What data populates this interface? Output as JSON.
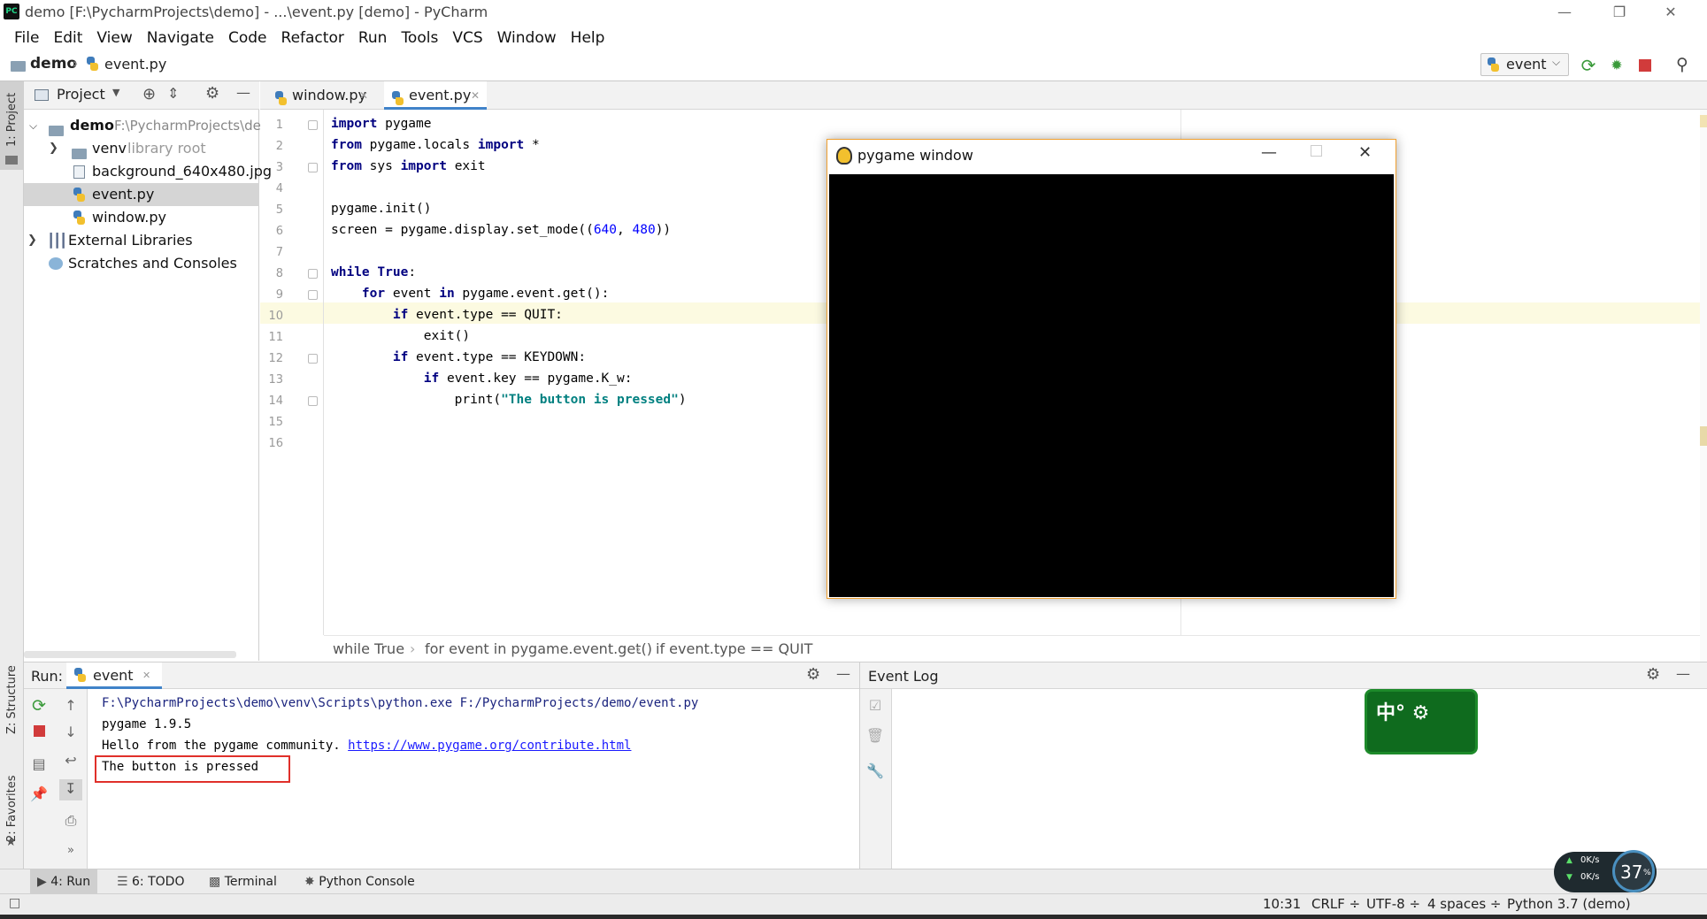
{
  "window": {
    "app_icon": "PC",
    "title": "demo [F:\\PycharmProjects\\demo] - ...\\event.py [demo] - PyCharm",
    "minimize_icon": "minimize-icon",
    "restore_icon": "restore-icon",
    "close_icon": "close-icon"
  },
  "menu": [
    "File",
    "Edit",
    "View",
    "Navigate",
    "Code",
    "Refactor",
    "Run",
    "Tools",
    "VCS",
    "Window",
    "Help"
  ],
  "navbar": {
    "project": "demo",
    "file": "event.py",
    "run_config": "event"
  },
  "left_strip": {
    "project": "1: Project",
    "structure": "Z: Structure",
    "favorites": "2: Favorites"
  },
  "project_panel": {
    "title": "Project",
    "tree": [
      {
        "label": "demo",
        "extra": "F:\\PycharmProjects\\de"
      },
      {
        "label": "venv",
        "extra": "library root"
      },
      {
        "label": "background_640x480.jpg"
      },
      {
        "label": "event.py"
      },
      {
        "label": "window.py"
      },
      {
        "label": "External Libraries"
      },
      {
        "label": "Scratches and Consoles"
      }
    ]
  },
  "editor": {
    "tabs": [
      "window.py",
      "event.py"
    ],
    "line_numbers": [
      "1",
      "2",
      "3",
      "4",
      "5",
      "6",
      "7",
      "8",
      "9",
      "10",
      "11",
      "12",
      "13",
      "14",
      "15",
      "16"
    ],
    "breadcrumbs": [
      "while True",
      "for event in pygame.event.get()",
      "if event.type == QUIT"
    ]
  },
  "pygame_window": {
    "title": "pygame window"
  },
  "run_panel": {
    "label": "Run:",
    "tab": "event",
    "output": {
      "path": "F:\\PycharmProjects\\demo\\venv\\Scripts\\python.exe F:/PycharmProjects/demo/event.py",
      "version": "pygame 1.9.5",
      "hello_prefix": "Hello from the pygame community. ",
      "hello_link": "https://www.pygame.org/contribute.html",
      "pressed": "The button is pressed"
    }
  },
  "event_log": {
    "title": "Event Log",
    "ime_badge": "中° ⚙"
  },
  "bottom_tools": [
    "4: Run",
    "6: TODO",
    "Terminal",
    "Python Console"
  ],
  "statusbar": {
    "position": "10:31",
    "line_sep": "CRLF ÷",
    "encoding": "UTF-8 ÷",
    "indent": "4 spaces ÷",
    "interpreter": "Python 3.7 (demo)",
    "net_up": "0K/s",
    "net_down": "0K/s",
    "cpu": "37",
    "cpu_unit": "%"
  },
  "colors": {
    "accent": "#4083c9",
    "keyword": "#000080",
    "string": "#008080",
    "number": "#0000ff",
    "highlight_box": "#e0302a",
    "current_line": "#fcfae1"
  }
}
